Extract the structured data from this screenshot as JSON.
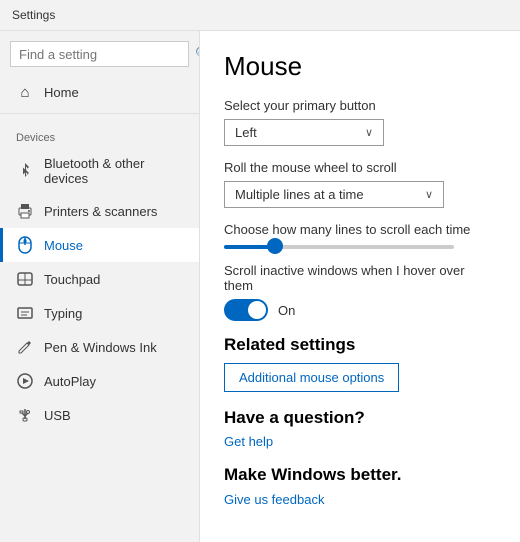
{
  "titleBar": {
    "label": "Settings"
  },
  "sidebar": {
    "search": {
      "placeholder": "Find a setting"
    },
    "sectionLabel": "Devices",
    "items": [
      {
        "id": "home",
        "label": "Home",
        "icon": "⌂"
      },
      {
        "id": "bluetooth",
        "label": "Bluetooth & other devices",
        "icon": "⚡"
      },
      {
        "id": "printers",
        "label": "Printers & scanners",
        "icon": "🖨"
      },
      {
        "id": "mouse",
        "label": "Mouse",
        "icon": "🖱",
        "active": true
      },
      {
        "id": "touchpad",
        "label": "Touchpad",
        "icon": "⬜"
      },
      {
        "id": "typing",
        "label": "Typing",
        "icon": "⌨"
      },
      {
        "id": "pen",
        "label": "Pen & Windows Ink",
        "icon": "✏"
      },
      {
        "id": "autoplay",
        "label": "AutoPlay",
        "icon": "▶"
      },
      {
        "id": "usb",
        "label": "USB",
        "icon": "⚙"
      }
    ]
  },
  "main": {
    "title": "Mouse",
    "primaryButton": {
      "label": "Select your primary button",
      "value": "Left",
      "chevron": "∨"
    },
    "scrollWheel": {
      "label": "Roll the mouse wheel to scroll",
      "value": "Multiple lines at a time",
      "chevron": "∨"
    },
    "scrollLines": {
      "label": "Choose how many lines to scroll each time"
    },
    "scrollInactive": {
      "label": "Scroll inactive windows when I hover over them",
      "toggleState": "On"
    },
    "relatedSettings": {
      "title": "Related settings",
      "link": "Additional mouse options"
    },
    "question": {
      "title": "Have a question?",
      "link": "Get help"
    },
    "windowsBetter": {
      "title": "Make Windows better.",
      "link": "Give us feedback"
    }
  }
}
